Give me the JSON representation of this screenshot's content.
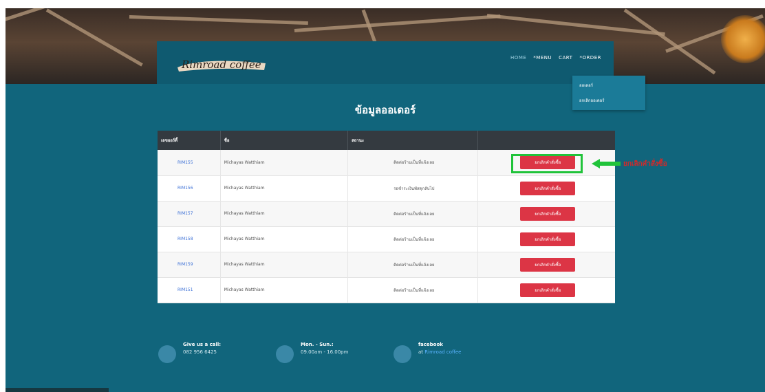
{
  "nav": {
    "logo_text": "Rimroad coffee",
    "links": [
      "HOME",
      "*MENU",
      "CART",
      "*ORDER"
    ],
    "dropdown": [
      "ออเดอร์",
      "ยกเลิกออเดอร์"
    ]
  },
  "page_title": "ข้อมูลออเดอร์",
  "table": {
    "headers": [
      "เลขออร์ดี้",
      "ชื่อ",
      "สถานะ",
      ""
    ],
    "rows": [
      {
        "id": "RIM155",
        "name": "Michayas Watthiam",
        "status": "ติดต่อร้านเป็นที่แจ้งเลย",
        "action": "ยกเลิกคำสั่งซื้อ"
      },
      {
        "id": "RIM156",
        "name": "Michayas Watthiam",
        "status": "รอชำระเงินพัสดุกลับไป",
        "action": "ยกเลิกคำสั่งซื้อ"
      },
      {
        "id": "RIM157",
        "name": "Michayas Watthiam",
        "status": "ติดต่อร้านเป็นที่แจ้งเลย",
        "action": "ยกเลิกคำสั่งซื้อ"
      },
      {
        "id": "RIM158",
        "name": "Michayas Watthiam",
        "status": "ติดต่อร้านเป็นที่แจ้งเลย",
        "action": "ยกเลิกคำสั่งซื้อ"
      },
      {
        "id": "RIM159",
        "name": "Michayas Watthiam",
        "status": "ติดต่อร้านเป็นที่แจ้งเลย",
        "action": "ยกเลิกคำสั่งซื้อ"
      },
      {
        "id": "RIM151",
        "name": "Michayas Watthiam",
        "status": "ติดต่อร้านเป็นที่แจ้งเลย",
        "action": "ยกเลิกคำสั่งซื้อ"
      }
    ]
  },
  "annotation": {
    "label": "ยกเลิกคำสั่งซื้อ",
    "box_color": "#20c33a",
    "text_color": "#d12a2a"
  },
  "footer": {
    "items": [
      {
        "title": "Give us a call:",
        "sub": "082 956 6425"
      },
      {
        "title": "Mon. - Sun.:",
        "sub": "09.00am - 16.00pm"
      },
      {
        "title": "facebook",
        "sub": "at",
        "link": "Rimroad coffee"
      }
    ]
  },
  "colors": {
    "brand": "#11657c",
    "danger": "#dc3545",
    "table_header": "#343a40"
  }
}
